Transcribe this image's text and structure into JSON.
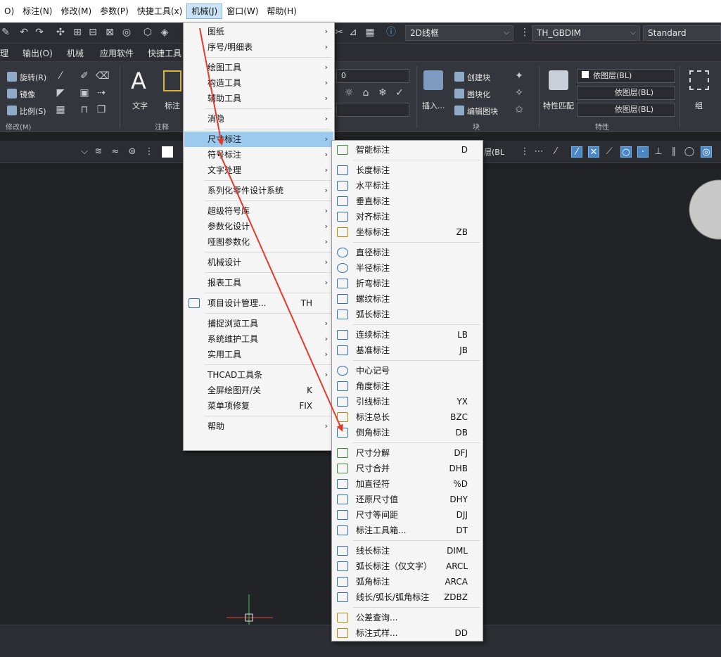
{
  "menubar": {
    "items": [
      "O)",
      "标注(N)",
      "修改(M)",
      "参数(P)",
      "快捷工具(x)",
      "机械(J)",
      "窗口(W)",
      "帮助(H)"
    ]
  },
  "qat": {
    "visual_style": "2D线框",
    "dim_style": "TH_GBDIM",
    "text_style": "Standard"
  },
  "tabs": [
    "理",
    "输出(O)",
    "机械",
    "应用软件",
    "快捷工具"
  ],
  "ribbon": {
    "modify": {
      "rotate": "旋转(R)",
      "mirror": "镜像",
      "scale": "比例(S)",
      "group": "修改(M)"
    },
    "annotation": {
      "text": "文字",
      "dim": "标注",
      "group": "注释"
    },
    "layer": {
      "value": "0"
    },
    "block": {
      "insert": "插入...",
      "create": "创建块",
      "blockify": "图块化",
      "edit": "编辑图块",
      "group": "块"
    },
    "props": {
      "match": "特性匹配",
      "bylayer1": "依图层(BL)",
      "bylayer2": "依图层(BL)",
      "bylayer3": "依图层(BL)",
      "group": "特性"
    },
    "group_label": "组"
  },
  "toolbar2": {
    "layer_value": "层(BL"
  },
  "menu_main": [
    {
      "label": "图纸",
      "sub": true
    },
    {
      "label": "序号/明细表",
      "sub": true
    },
    {
      "label": "绘图工具",
      "sub": true
    },
    {
      "label": "构造工具",
      "sub": true
    },
    {
      "label": "辅助工具",
      "sub": true
    },
    {
      "label": "消隐",
      "sub": true
    },
    {
      "label": "尺寸标注",
      "sub": true,
      "highlighted": true
    },
    {
      "label": "符号标注",
      "sub": true
    },
    {
      "label": "文字处理",
      "sub": true
    },
    {
      "label": "系列化零件设计系统",
      "sub": true
    },
    {
      "label": "超级符号库",
      "sub": true
    },
    {
      "label": "参数化设计",
      "sub": true
    },
    {
      "label": "哑图参数化",
      "sub": true
    },
    {
      "label": "机械设计",
      "sub": true
    },
    {
      "label": "报表工具",
      "sub": true
    },
    {
      "label": "项目设计管理...",
      "shortcut": "TH"
    },
    {
      "label": "捕捉浏览工具",
      "sub": true
    },
    {
      "label": "系统维护工具",
      "sub": true
    },
    {
      "label": "实用工具",
      "sub": true
    },
    {
      "label": "THCAD工具条",
      "sub": true
    },
    {
      "label": "全屏绘图开/关",
      "shortcut": "K"
    },
    {
      "label": "菜单项修复",
      "shortcut": "FIX"
    },
    {
      "label": "帮助",
      "sub": true
    }
  ],
  "menu_sub": [
    {
      "label": "智能标注",
      "shortcut": "D"
    },
    {
      "label": "长度标注",
      "shortcut": ""
    },
    {
      "label": "水平标注",
      "shortcut": ""
    },
    {
      "label": "垂直标注",
      "shortcut": ""
    },
    {
      "label": "对齐标注",
      "shortcut": ""
    },
    {
      "label": "坐标标注",
      "shortcut": "ZB"
    },
    {
      "label": "直径标注",
      "shortcut": ""
    },
    {
      "label": "半径标注",
      "shortcut": ""
    },
    {
      "label": "折弯标注",
      "shortcut": ""
    },
    {
      "label": "螺纹标注",
      "shortcut": ""
    },
    {
      "label": "弧长标注",
      "shortcut": ""
    },
    {
      "label": "连续标注",
      "shortcut": "LB"
    },
    {
      "label": "基准标注",
      "shortcut": "JB"
    },
    {
      "label": "中心记号",
      "shortcut": ""
    },
    {
      "label": "角度标注",
      "shortcut": ""
    },
    {
      "label": "引线标注",
      "shortcut": "YX"
    },
    {
      "label": "标注总长",
      "shortcut": "BZC"
    },
    {
      "label": "倒角标注",
      "shortcut": "DB"
    },
    {
      "label": "尺寸分解",
      "shortcut": "DFJ"
    },
    {
      "label": "尺寸合并",
      "shortcut": "DHB"
    },
    {
      "label": "加直径符",
      "shortcut": "%D"
    },
    {
      "label": "还原尺寸值",
      "shortcut": "DHY"
    },
    {
      "label": "尺寸等间距",
      "shortcut": "DJJ"
    },
    {
      "label": "标注工具箱...",
      "shortcut": "DT"
    },
    {
      "label": "线长标注",
      "shortcut": "DIML"
    },
    {
      "label": "弧长标注（仅文字）",
      "shortcut": "ARCL"
    },
    {
      "label": "弧角标注",
      "shortcut": "ARCA"
    },
    {
      "label": "线长/弧长/弧角标注",
      "shortcut": "ZDBZ"
    },
    {
      "label": "公差查询...",
      "shortcut": ""
    },
    {
      "label": "标注式样...",
      "shortcut": "DD"
    }
  ],
  "colors": {
    "highlight": "#9ccaef",
    "arrow": "#e53a2a",
    "menubar_active": "#cce4f7"
  }
}
